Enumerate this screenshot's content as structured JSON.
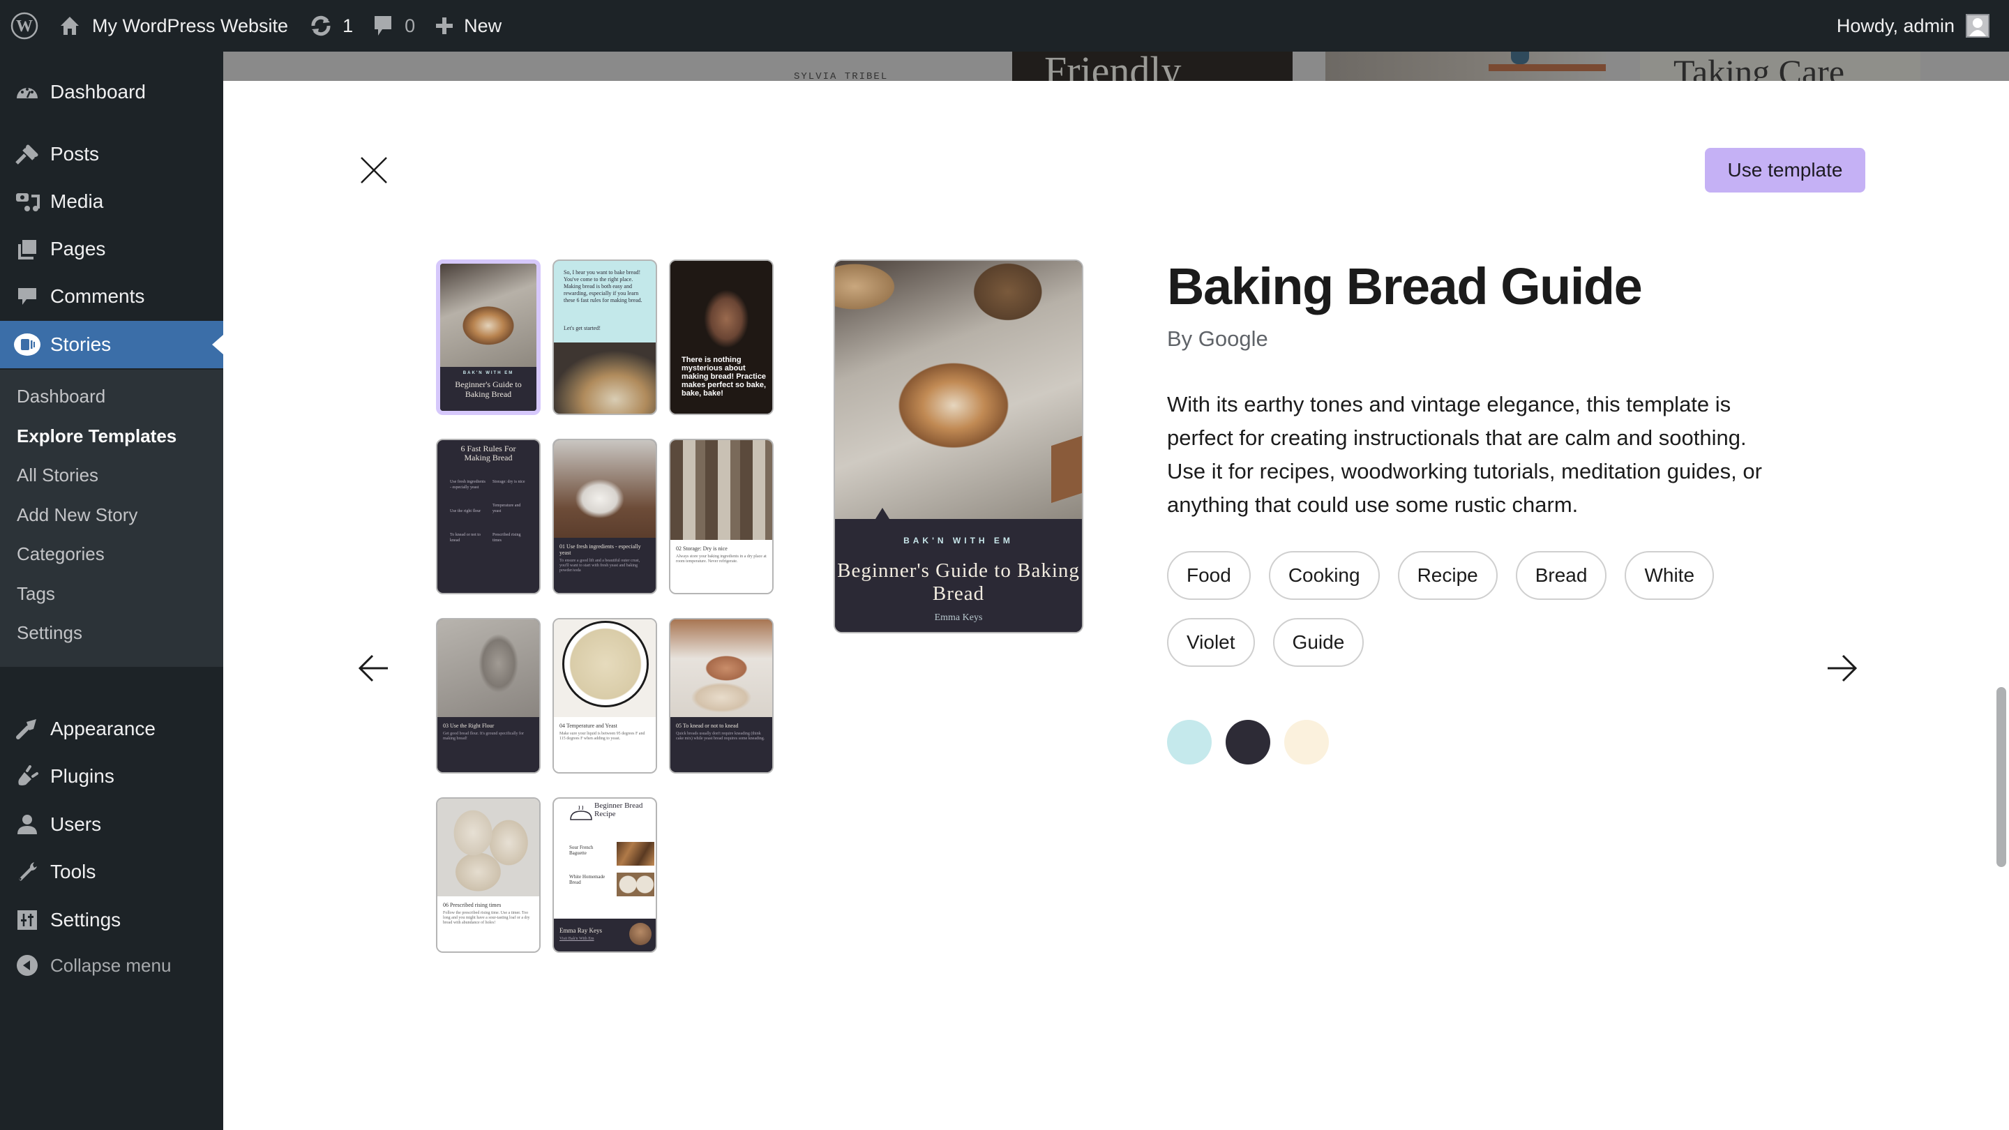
{
  "admin_bar": {
    "site_name": "My WordPress Website",
    "updates_count": "1",
    "comments_count": "0",
    "new_label": "New",
    "greeting": "Howdy, admin"
  },
  "sidebar": {
    "items": [
      {
        "label": "Dashboard",
        "icon": "dashboard-icon"
      },
      {
        "label": "Posts",
        "icon": "pushpin-icon"
      },
      {
        "label": "Media",
        "icon": "media-icon"
      },
      {
        "label": "Pages",
        "icon": "pages-icon"
      },
      {
        "label": "Comments",
        "icon": "comment-icon"
      },
      {
        "label": "Stories",
        "icon": "stories-icon",
        "current": true
      },
      {
        "label": "Appearance",
        "icon": "paintbrush-icon"
      },
      {
        "label": "Plugins",
        "icon": "plugin-icon"
      },
      {
        "label": "Users",
        "icon": "user-icon"
      },
      {
        "label": "Tools",
        "icon": "wrench-icon"
      },
      {
        "label": "Settings",
        "icon": "settings-icon"
      }
    ],
    "submenu": [
      {
        "label": "Dashboard"
      },
      {
        "label": "Explore Templates",
        "current": true
      },
      {
        "label": "All Stories"
      },
      {
        "label": "Add New Story"
      },
      {
        "label": "Categories"
      },
      {
        "label": "Tags"
      },
      {
        "label": "Settings"
      }
    ],
    "collapse_label": "Collapse menu"
  },
  "background": {
    "author_text": "SYLVIA TRIBEL",
    "card1_title": "Friendly",
    "card3_title": "Taking Care"
  },
  "modal": {
    "use_template_label": "Use template",
    "template": {
      "title": "Baking Bread Guide",
      "byline": "By Google",
      "description": "With its earthy tones and vintage elegance, this template is perfect for creating instructionals that are calm and soothing. Use it for recipes, woodworking tutorials, meditation guides, or anything that could use some rustic charm.",
      "tags": [
        "Food",
        "Cooking",
        "Recipe",
        "Bread",
        "White",
        "Violet",
        "Guide"
      ],
      "colors": [
        "#c5e9ec",
        "#2d2b36",
        "#fbf1dd"
      ]
    },
    "preview": {
      "kicker": "BAK'N WITH EM",
      "title": "Beginner's Guide to Baking Bread",
      "author": "Emma Keys"
    },
    "pages": [
      {
        "title": "Beginner's Guide to Baking Bread",
        "kicker": "BAK'N WITH EM",
        "author": "Emma Keys"
      },
      {
        "text": "So, I hear you want to bake bread! You've come to the right place. Making bread is both easy and rewarding, especially if you learn these 6 fast rules for making bread.",
        "cta": "Let's get started!"
      },
      {
        "quote": "There is nothing mysterious about making bread! Practice makes perfect so bake, bake, bake!"
      },
      {
        "title": "6 Fast Rules For Making Bread",
        "rules": [
          "Use fresh ingredients - especially yeast",
          "Storage: dry is nice",
          "Use the right flour",
          "Temperature and yeast",
          "To knead or not to knead",
          "Prescribed rising times"
        ]
      },
      {
        "num": "01",
        "title": "Use fresh ingredients - especially yeast",
        "body": "To ensure a good lift and a beautiful outer crust, you'll want to start with fresh yeast and baking powder/soda"
      },
      {
        "num": "02",
        "title": "Storage: Dry is nice",
        "body": "Always store your baking ingredients in a dry place at room temperature. Never refrigerate."
      },
      {
        "num": "03",
        "title": "Use the Right Flour",
        "body": "Get good bread flour. It's ground specifically for making bread!"
      },
      {
        "num": "04",
        "title": "Temperature and Yeast",
        "body": "Make sure your liquid is between 95 degrees F and 115 degrees F when adding to yeast."
      },
      {
        "num": "05",
        "title": "To knead or not to knead",
        "body": "Quick breads usually don't require kneading (think cake mix) while yeast bread requires some kneading."
      },
      {
        "num": "06",
        "title": "Prescribed rising times",
        "body": "Follow the prescribed rising time. Use a timer. Too long and you might have a sour-tasting loaf or a dry bread with abundance of holes!"
      },
      {
        "title": "Beginner Bread Recipe",
        "items": [
          "Sour French Baguette",
          "White Homemade Bread"
        ],
        "author": "Emma Ray Keys",
        "link": "Visit Bak'n With Em"
      }
    ]
  }
}
